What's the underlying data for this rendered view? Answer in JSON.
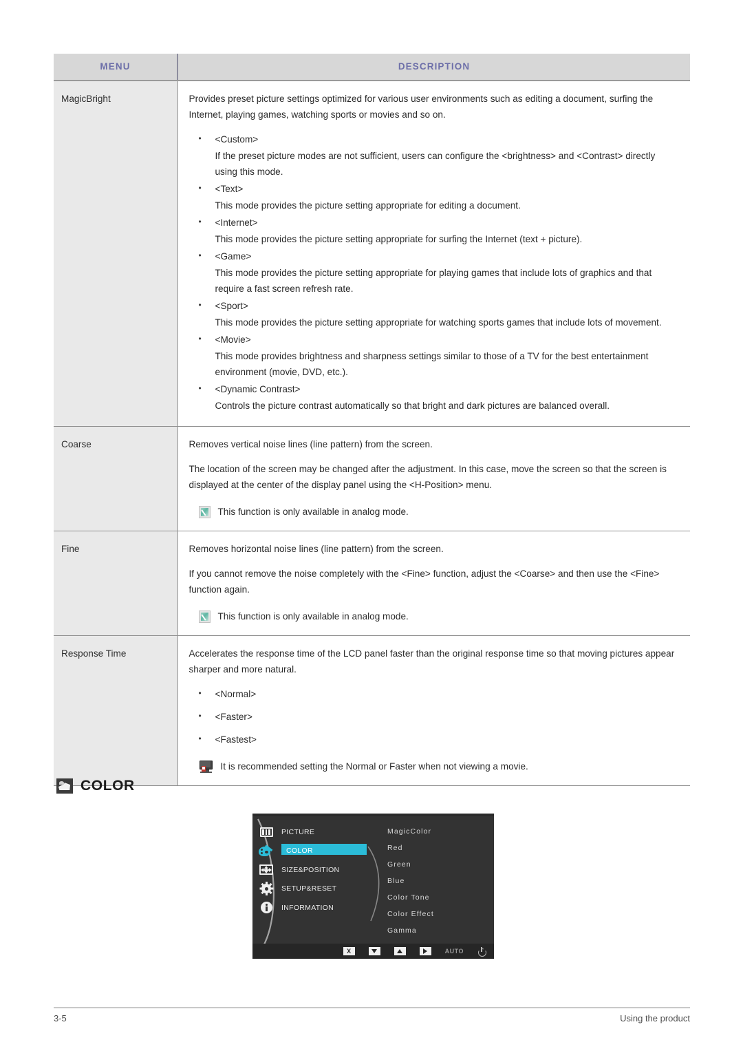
{
  "table": {
    "headers": {
      "menu": "MENU",
      "description": "DESCRIPTION"
    },
    "rows": [
      {
        "menu": "MagicBright",
        "intro": "Provides preset picture settings optimized for various user environments such as editing a document, surfing the Internet, playing games, watching sports or movies and so on.",
        "items": [
          {
            "term": "<Custom>",
            "desc": "If the preset picture modes are not sufficient, users can configure the <brightness> and <Contrast> directly using this mode."
          },
          {
            "term": "<Text>",
            "desc": "This mode provides the picture setting appropriate for editing a document."
          },
          {
            "term": "<Internet>",
            "desc": "This mode provides the picture setting appropriate for surfing the Internet (text + picture)."
          },
          {
            "term": "<Game>",
            "desc": "This mode provides the picture setting appropriate for playing games that include lots of graphics and that require a fast screen refresh rate."
          },
          {
            "term": "<Sport>",
            "desc": "This mode provides the picture setting appropriate for watching sports games that include lots of movement."
          },
          {
            "term": "<Movie>",
            "desc": "This mode provides brightness and sharpness settings similar to those of a TV for the best entertainment environment (movie, DVD, etc.)."
          },
          {
            "term": "<Dynamic Contrast>",
            "desc": "Controls the picture contrast automatically so that bright and dark pictures are balanced overall."
          }
        ]
      },
      {
        "menu": "Coarse",
        "p1": "Removes vertical noise lines (line pattern) from the screen.",
        "p2": "The location of the screen may be changed after the adjustment. In this case, move the screen so that the screen is displayed at the center of the display panel using the <H-Position> menu.",
        "note": "This function is only available in analog mode.",
        "note_icon": "note-icon"
      },
      {
        "menu": "Fine",
        "p1": "Removes horizontal noise lines (line pattern) from the screen.",
        "p2": "If you cannot remove the noise completely with the <Fine> function, adjust the <Coarse> and then use the <Fine> function again.",
        "note": "This function is only available in analog mode.",
        "note_icon": "note-icon"
      },
      {
        "menu": "Response Time",
        "p1": "Accelerates the response time of the LCD panel faster than the original response time so that moving pictures appear sharper and more natural.",
        "bullets": [
          "<Normal>",
          "<Faster>",
          "<Fastest>"
        ],
        "note": "It is recommended setting the Normal or Faster when not viewing a movie.",
        "note_icon": "monitor-icon"
      }
    ]
  },
  "section": {
    "icon": "color-section-icon",
    "title": "COLOR"
  },
  "osd": {
    "left_menu": [
      {
        "label": "PICTURE",
        "icon": "picture-icon",
        "active": false
      },
      {
        "label": "COLOR",
        "icon": "palette-icon",
        "active": true
      },
      {
        "label": "SIZE&POSITION",
        "icon": "size-position-icon",
        "active": false
      },
      {
        "label": "SETUP&RESET",
        "icon": "gear-icon",
        "active": false
      },
      {
        "label": "INFORMATION",
        "icon": "info-icon",
        "active": false
      }
    ],
    "right_items": [
      "MagicColor",
      "Red",
      "Green",
      "Blue",
      "Color Tone",
      "Color Effect",
      "Gamma"
    ],
    "buttons": [
      {
        "name": "exit-button",
        "glyph": "X",
        "kind": "box"
      },
      {
        "name": "down-button",
        "glyph": "",
        "kind": "down"
      },
      {
        "name": "up-button",
        "glyph": "",
        "kind": "up"
      },
      {
        "name": "enter-button",
        "glyph": "",
        "kind": "right"
      },
      {
        "name": "auto-button",
        "glyph": "AUTO",
        "kind": "text"
      },
      {
        "name": "power-button",
        "glyph": "",
        "kind": "power"
      }
    ],
    "highlight_color": "#2bbcd8"
  },
  "footer": {
    "page_number": "3-5",
    "section_label": "Using the product"
  },
  "colors": {
    "header_bg": "#d7d7d7",
    "header_text": "#6d6fa9",
    "menu_cell_bg": "#e9e9e9",
    "accent_teal": "#2bbcd8"
  }
}
